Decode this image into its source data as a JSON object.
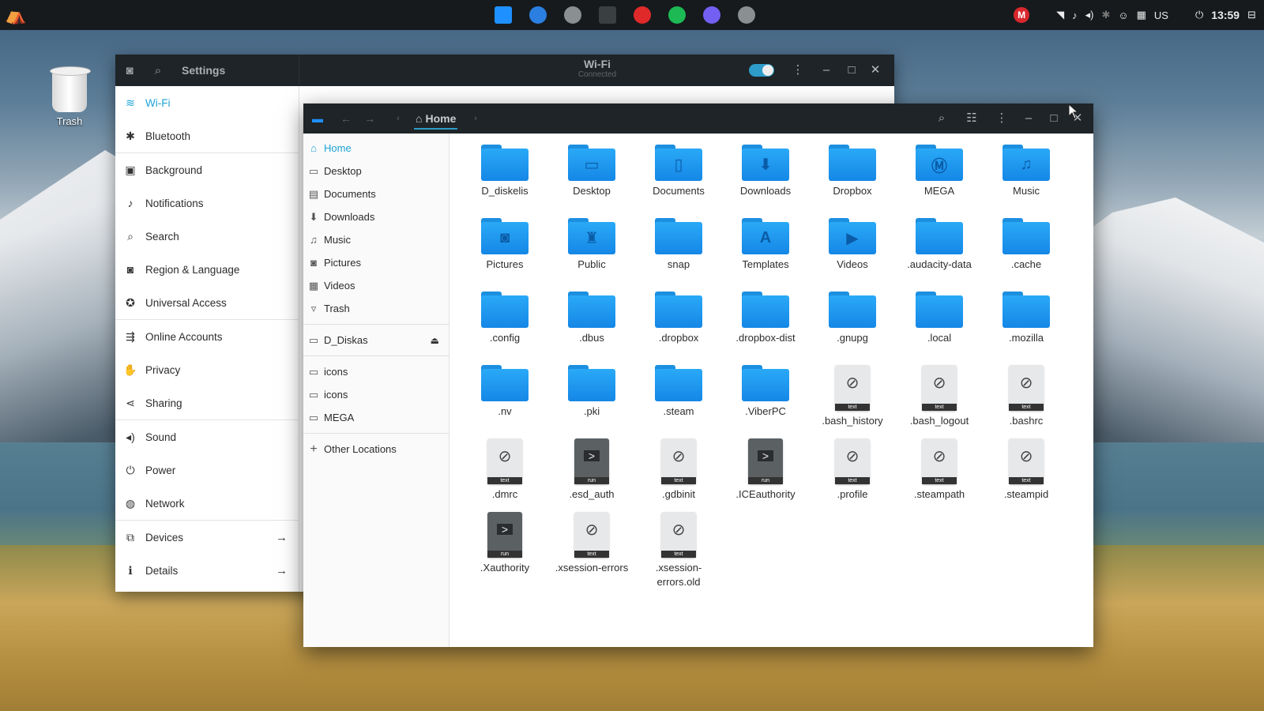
{
  "topbar": {
    "dock": [
      {
        "icon": "files-icon",
        "color": "#1e90ff"
      },
      {
        "icon": "download-manager-icon",
        "color": "#2b7fe0"
      },
      {
        "icon": "settings-icon",
        "color": "#8a8f92"
      },
      {
        "icon": "terminal-icon",
        "color": "#3a3f42"
      },
      {
        "icon": "opera-icon",
        "color": "#e02a2a"
      },
      {
        "icon": "spotify-icon",
        "color": "#1db954"
      },
      {
        "icon": "viber-icon",
        "color": "#7360f2"
      },
      {
        "icon": "settings-icon",
        "color": "#8a8f92"
      }
    ],
    "tray": {
      "mega": "M",
      "keyboard": "US",
      "clock": "13:59"
    }
  },
  "desktop": {
    "trash_label": "Trash"
  },
  "settings": {
    "title": "Settings",
    "panel_title": "Wi-Fi",
    "panel_subtitle": "Connected",
    "items": [
      {
        "label": "Wi-Fi",
        "icon": "wifi-icon",
        "glyph": "≋",
        "active": true
      },
      {
        "label": "Bluetooth",
        "icon": "bluetooth-icon",
        "glyph": "✱"
      },
      {
        "label": "Background",
        "icon": "background-icon",
        "glyph": "▣"
      },
      {
        "label": "Notifications",
        "icon": "bell-icon",
        "glyph": "♪"
      },
      {
        "label": "Search",
        "icon": "search-icon",
        "glyph": "⌕"
      },
      {
        "label": "Region & Language",
        "icon": "camera-icon",
        "glyph": "◙"
      },
      {
        "label": "Universal Access",
        "icon": "accessibility-icon",
        "glyph": "✪"
      },
      {
        "label": "Online Accounts",
        "icon": "online-accounts-icon",
        "glyph": "⇶"
      },
      {
        "label": "Privacy",
        "icon": "hand-icon",
        "glyph": "✋"
      },
      {
        "label": "Sharing",
        "icon": "share-icon",
        "glyph": "⋖"
      },
      {
        "label": "Sound",
        "icon": "speaker-icon",
        "glyph": "◂)"
      },
      {
        "label": "Power",
        "icon": "power-plug-icon",
        "glyph": "⏻"
      },
      {
        "label": "Network",
        "icon": "network-icon",
        "glyph": "◍"
      },
      {
        "label": "Devices",
        "icon": "devices-icon",
        "glyph": "⧉",
        "arrow": "→"
      },
      {
        "label": "Details",
        "icon": "info-icon",
        "glyph": "ℹ",
        "arrow": "→"
      }
    ]
  },
  "files": {
    "breadcrumb": "Home",
    "places": [
      {
        "label": "Home",
        "icon": "home-icon",
        "glyph": "⌂",
        "active": true
      },
      {
        "label": "Desktop",
        "icon": "desktop-icon",
        "glyph": "▭"
      },
      {
        "label": "Documents",
        "icon": "documents-icon",
        "glyph": "▤"
      },
      {
        "label": "Downloads",
        "icon": "downloads-icon",
        "glyph": "⬇"
      },
      {
        "label": "Music",
        "icon": "music-icon",
        "glyph": "♫"
      },
      {
        "label": "Pictures",
        "icon": "pictures-icon",
        "glyph": "◙"
      },
      {
        "label": "Videos",
        "icon": "videos-icon",
        "glyph": "▦"
      },
      {
        "label": "Trash",
        "icon": "trash-icon",
        "glyph": "▿"
      }
    ],
    "devices": [
      {
        "label": "D_Diskas",
        "icon": "drive-icon",
        "glyph": "▭",
        "eject": "⏏"
      }
    ],
    "bookmarks": [
      {
        "label": "icons",
        "icon": "folder-icon",
        "glyph": "▭"
      },
      {
        "label": "icons",
        "icon": "folder-icon",
        "glyph": "▭"
      },
      {
        "label": "MEGA",
        "icon": "folder-icon",
        "glyph": "▭"
      }
    ],
    "other_locations": "Other Locations",
    "items": [
      {
        "name": "D_diskelis",
        "kind": "folder",
        "glyph": "",
        "link": true
      },
      {
        "name": "Desktop",
        "kind": "folder",
        "glyph": "▭"
      },
      {
        "name": "Documents",
        "kind": "folder",
        "glyph": "▯"
      },
      {
        "name": "Downloads",
        "kind": "folder",
        "glyph": "⬇"
      },
      {
        "name": "Dropbox",
        "kind": "folder",
        "glyph": ""
      },
      {
        "name": "MEGA",
        "kind": "folder",
        "glyph": "Ⓜ"
      },
      {
        "name": "Music",
        "kind": "folder",
        "glyph": "♫"
      },
      {
        "name": "Pictures",
        "kind": "folder",
        "glyph": "◙"
      },
      {
        "name": "Public",
        "kind": "folder",
        "glyph": "♜"
      },
      {
        "name": "snap",
        "kind": "folder",
        "glyph": ""
      },
      {
        "name": "Templates",
        "kind": "folder",
        "glyph": "A"
      },
      {
        "name": "Videos",
        "kind": "folder",
        "glyph": "▶"
      },
      {
        "name": ".audacity-data",
        "kind": "folder",
        "glyph": ""
      },
      {
        "name": ".cache",
        "kind": "folder",
        "glyph": ""
      },
      {
        "name": ".config",
        "kind": "folder",
        "glyph": ""
      },
      {
        "name": ".dbus",
        "kind": "folder",
        "glyph": ""
      },
      {
        "name": ".dropbox",
        "kind": "folder",
        "glyph": ""
      },
      {
        "name": ".dropbox-dist",
        "kind": "folder",
        "glyph": ""
      },
      {
        "name": ".gnupg",
        "kind": "folder",
        "glyph": ""
      },
      {
        "name": ".local",
        "kind": "folder",
        "glyph": ""
      },
      {
        "name": ".mozilla",
        "kind": "folder",
        "glyph": ""
      },
      {
        "name": ".nv",
        "kind": "folder",
        "glyph": ""
      },
      {
        "name": ".pki",
        "kind": "folder",
        "glyph": ""
      },
      {
        "name": ".steam",
        "kind": "folder",
        "glyph": ""
      },
      {
        "name": ".ViberPC",
        "kind": "folder",
        "glyph": ""
      },
      {
        "name": ".bash_history",
        "kind": "text",
        "tag": "text"
      },
      {
        "name": ".bash_logout",
        "kind": "text",
        "tag": "text"
      },
      {
        "name": ".bashrc",
        "kind": "text",
        "tag": "text"
      },
      {
        "name": ".dmrc",
        "kind": "text",
        "tag": "text"
      },
      {
        "name": ".esd_auth",
        "kind": "run",
        "tag": "run"
      },
      {
        "name": ".gdbinit",
        "kind": "text",
        "tag": "text"
      },
      {
        "name": ".ICEauthority",
        "kind": "run",
        "tag": "run"
      },
      {
        "name": ".profile",
        "kind": "text",
        "tag": "text"
      },
      {
        "name": ".steampath",
        "kind": "text",
        "tag": "text"
      },
      {
        "name": ".steampid",
        "kind": "text",
        "tag": "text"
      },
      {
        "name": ".Xauthority",
        "kind": "run",
        "tag": "run"
      },
      {
        "name": ".xsession-errors",
        "kind": "text",
        "tag": "text"
      },
      {
        "name": ".xsession-errors.old",
        "kind": "text",
        "tag": "text"
      }
    ]
  }
}
